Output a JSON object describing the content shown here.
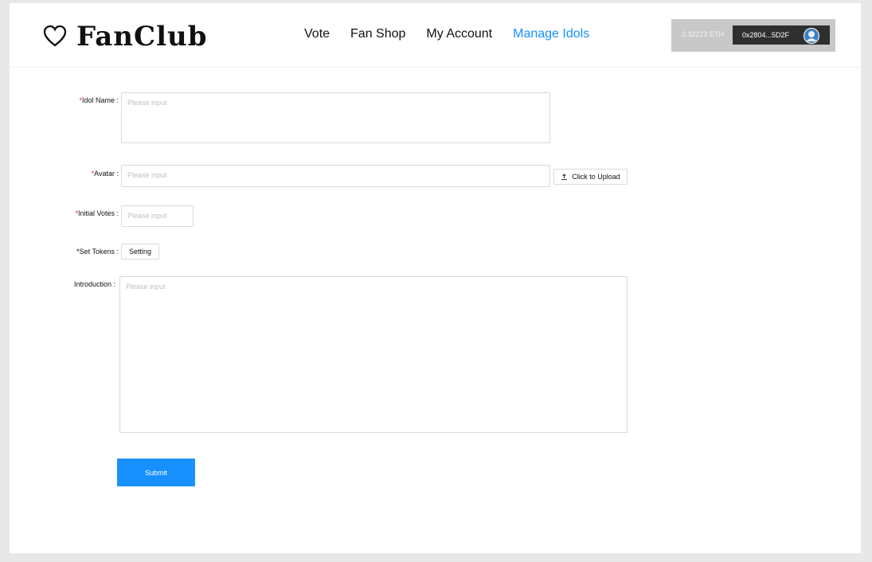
{
  "header": {
    "logo_text": "FanClub",
    "nav": [
      "Vote",
      "Fan Shop",
      "My Account",
      "Manage Idols"
    ],
    "active_nav": "Manage Idols",
    "wallet": {
      "balance": "0.32223 ETH",
      "address": "0x2804...5D2F"
    }
  },
  "form": {
    "required_mark": "*",
    "idol_name": {
      "label": "Idol Name",
      "placeholder": "Please input"
    },
    "avatar": {
      "label": "Avatar",
      "placeholder": "Please input",
      "upload_label": "Click to Upload"
    },
    "initial_votes": {
      "label": "Initial Votes",
      "placeholder": "Please input"
    },
    "set_tokens": {
      "label": "Set Tokens",
      "button_label": "Setting"
    },
    "introduction": {
      "label": "Introduction",
      "placeholder": "Please input"
    },
    "submit_label": "Submit"
  },
  "colors": {
    "accent": "#1890ff",
    "required": "#f5222d",
    "wallet_bg": "#c8c8c8",
    "address_bg": "#2f2f2f"
  },
  "icons": {
    "logo": "heart-outline-icon",
    "upload": "upload-icon",
    "wallet_avatar": "avatar-icon"
  }
}
